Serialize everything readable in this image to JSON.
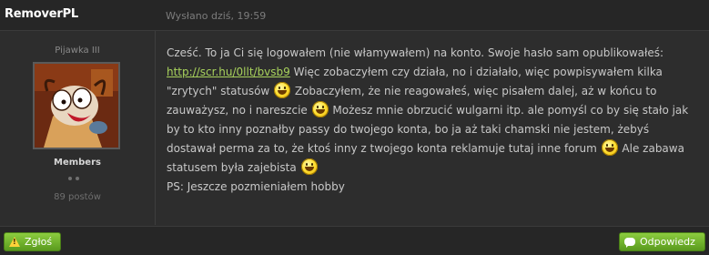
{
  "post": {
    "author": "RemoverPL",
    "date": "Wysłano dziś, 19:59"
  },
  "user": {
    "rank_title": "Pijawka III",
    "group": "Members",
    "post_count": "89 postów"
  },
  "message": {
    "seg1": "Cześć. To ja Ci się logowałem (nie włamywałem) na konto. Swoje hasło sam opublikowałeś: ",
    "link": "http://scr.hu/0llt/bvsb9",
    "seg2": " Więc zobaczyłem czy działa, no i działało, więc powpisywałem kilka \"zrytych\" statusów ",
    "seg3": " Zobaczyłem, że nie reagowałeś, więc pisałem dalej, aż w końcu to zauważysz, no i nareszcie ",
    "seg4": " Możesz mnie obrzucić wulgarni itp. ale pomyśl co by się stało jak by to kto inny poznałby passy do twojego konta, bo ja aż taki chamski nie jestem, żebyś dostawał perma za to, że ktoś inny z twojego konta reklamuje tutaj inne forum ",
    "seg5": " Ale zabawa statusem była zajebista ",
    "ps": "PS: Jeszcze pozmieniałem hobby"
  },
  "actions": {
    "report_label": "Zgłoś",
    "reply_label": "Odpowiedz"
  },
  "icons": {
    "smiley": "biggrin-smiley",
    "report": "warning-icon",
    "reply": "speech-bubble-icon"
  },
  "colors": {
    "background": "#2d2d2d",
    "link": "#a8d25c",
    "button": "#6aad2a"
  }
}
